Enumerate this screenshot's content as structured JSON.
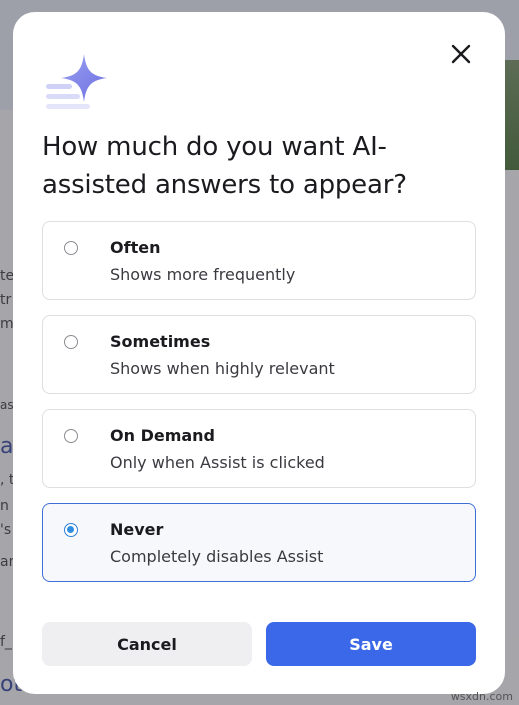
{
  "dialog": {
    "title": "How much do you want AI-assisted answers to appear?",
    "close_label": "Close",
    "options": [
      {
        "label": "Often",
        "description": "Shows more frequently",
        "selected": false
      },
      {
        "label": "Sometimes",
        "description": "Shows when highly relevant",
        "selected": false
      },
      {
        "label": "On Demand",
        "description": "Only when Assist is clicked",
        "selected": false
      },
      {
        "label": "Never",
        "description": "Completely disables Assist",
        "selected": true
      }
    ],
    "cancel_label": "Cancel",
    "save_label": "Save"
  },
  "background": {
    "fragments": [
      "te",
      "tr",
      "mi",
      "as",
      "a",
      ", t",
      "n u",
      "'s",
      "an",
      "f_",
      "ot"
    ]
  },
  "watermark": "wsxdn.com",
  "colors": {
    "primary": "#3b68e8",
    "radio_selected": "#2f8ee0",
    "sparkle": "#7b7fe6"
  },
  "icons": {
    "close": "close-icon",
    "sparkle": "sparkle-icon"
  }
}
